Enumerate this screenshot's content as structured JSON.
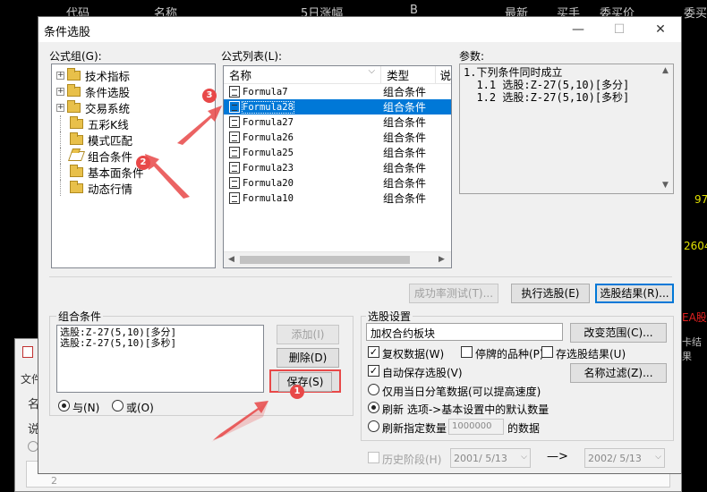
{
  "background": {
    "header_cols": [
      "代码",
      "名称",
      "5日涨幅",
      "B",
      "最新",
      "买手",
      "委买价",
      "委买"
    ],
    "right_values": [
      "97",
      "2604"
    ],
    "right_red": "EA股",
    "right_yellow": "卡结果",
    "left_menu": [
      "文件",
      "名",
      "说"
    ],
    "left_number": "2"
  },
  "dialog": {
    "title": "条件选股",
    "minimize": "—",
    "maximize": "☐",
    "close": "✕",
    "formula_group_label": "公式组(G):",
    "tree_items": [
      {
        "label": "技术指标",
        "expandable": true
      },
      {
        "label": "条件选股",
        "expandable": true
      },
      {
        "label": "交易系统",
        "expandable": true
      },
      {
        "label": "五彩K线",
        "expandable": false
      },
      {
        "label": "模式匹配",
        "expandable": false
      },
      {
        "label": "组合条件",
        "expandable": false
      },
      {
        "label": "基本面条件",
        "expandable": false
      },
      {
        "label": "动态行情",
        "expandable": false
      }
    ],
    "formula_list_label": "公式列表(L):",
    "list_headers": [
      "名称",
      "类型",
      "说"
    ],
    "list_rows": [
      {
        "name": "Formula7",
        "type": "组合条件"
      },
      {
        "name": "Formula28",
        "type": "组合条件"
      },
      {
        "name": "Formula27",
        "type": "组合条件"
      },
      {
        "name": "Formula26",
        "type": "组合条件"
      },
      {
        "name": "Formula25",
        "type": "组合条件"
      },
      {
        "name": "Formula23",
        "type": "组合条件"
      },
      {
        "name": "Formula20",
        "type": "组合条件"
      },
      {
        "name": "Formula10",
        "type": "组合条件"
      }
    ],
    "selected_row": 1,
    "params_label": "参数:",
    "params_lines": [
      "1.下列条件同时成立",
      "  1.1 选股:Z-27(5,10)[多分]",
      "  1.2 选股:Z-27(5,10)[多秒]"
    ],
    "success_rate_button": "成功率测试(T)...",
    "execute_button": "执行选股(E)",
    "result_button": "选股结果(R)...",
    "combo_label": "组合条件",
    "combo_lines": [
      "选股:Z-27(5,10)[多分]",
      "选股:Z-27(5,10)[多秒]"
    ],
    "add_button": "添加(I)",
    "delete_button": "删除(D)",
    "save_button": "保存(S)",
    "and_label": "与(N)",
    "or_label": "或(O)",
    "settings_label": "选股设置",
    "block_value": "加权合约板块",
    "change_range_button": "改变范围(C)...",
    "restore_data": "复权数据(W)",
    "suspended": "停牌的品种(P)",
    "stock_result": "存选股结果(U)",
    "auto_save": "自动保存选股(V)",
    "name_filter_button": "名称过滤(Z)...",
    "intraday_only": "仅用当日分笔数据(可以提高速度)",
    "refresh_default": "刷新 选项->基本设置中的默认数量",
    "refresh_specified": "刷新指定数量",
    "refresh_count": "1000000",
    "refresh_suffix": "的数据",
    "history_stage": "历史阶段(H)",
    "date_from": "2001/ 5/13",
    "arrow": "—>",
    "date_to": "2002/ 5/13",
    "step_badges": [
      "1",
      "2",
      "3"
    ],
    "accent_color": "#0078d7",
    "annotation_color": "#e84848"
  }
}
